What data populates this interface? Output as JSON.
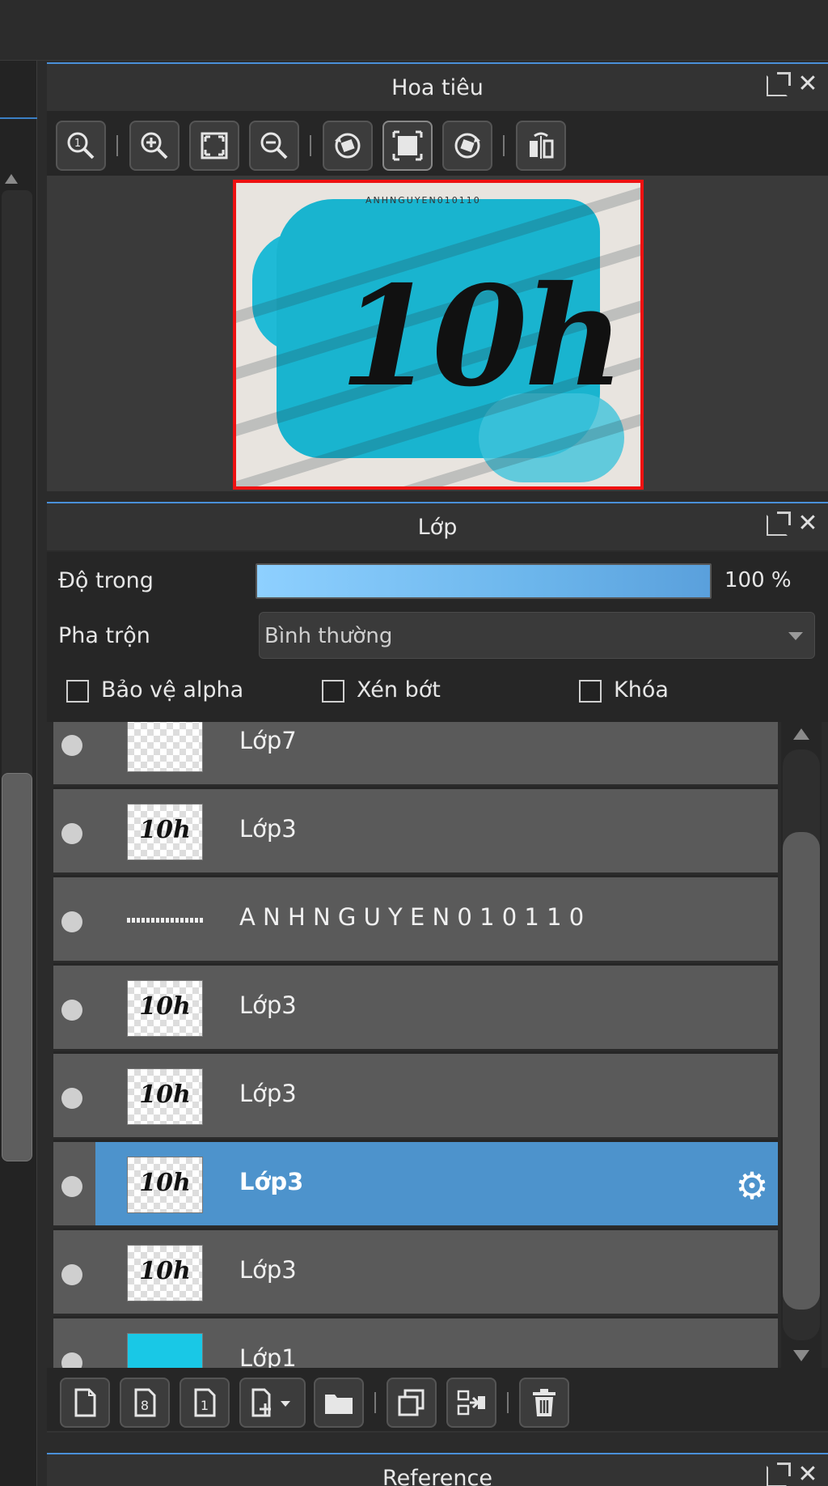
{
  "navigator": {
    "title": "Hoa tiêu",
    "preview_big_text": "10h",
    "preview_small_text": "ANHNGUYEN010110",
    "toolbar": [
      {
        "icon": "zoom-actual-icon"
      },
      {
        "icon": "zoom-in-icon"
      },
      {
        "icon": "fit-window-icon"
      },
      {
        "icon": "zoom-out-icon"
      },
      {
        "icon": "rotate-left-icon"
      },
      {
        "icon": "reset-view-icon"
      },
      {
        "icon": "rotate-right-icon"
      },
      {
        "icon": "flip-icon"
      }
    ]
  },
  "layers": {
    "title": "Lớp",
    "opacity_label": "Độ trong",
    "opacity_value": "100 %",
    "blend_label": "Pha trộn",
    "blend_value": "Bình thường",
    "protect_alpha": "Bảo vệ alpha",
    "clipping": "Xén bớt",
    "lock": "Khóa",
    "items": [
      {
        "name": "Lớp7",
        "thumb": "empty",
        "selected": false
      },
      {
        "name": "Lớp3",
        "thumb": "10h",
        "selected": false
      },
      {
        "name": "A N H N G U Y E N 0 1 0 1 1 0",
        "thumb": "text",
        "selected": false
      },
      {
        "name": "Lớp3",
        "thumb": "10h",
        "selected": false
      },
      {
        "name": "Lớp3",
        "thumb": "10h",
        "selected": false
      },
      {
        "name": "Lớp3",
        "thumb": "10h",
        "selected": true
      },
      {
        "name": "Lớp3",
        "thumb": "10h",
        "selected": false
      },
      {
        "name": "Lớp1",
        "thumb": "cyan",
        "selected": false
      }
    ],
    "thumb_text": "10h",
    "toolbar": [
      {
        "icon": "new-layer-icon"
      },
      {
        "icon": "new-8bit-layer-icon"
      },
      {
        "icon": "new-1bit-layer-icon"
      },
      {
        "icon": "add-layer-dropdown-icon"
      },
      {
        "icon": "folder-icon"
      },
      {
        "icon": "duplicate-layer-icon"
      },
      {
        "icon": "merge-down-icon"
      },
      {
        "icon": "trash-icon"
      }
    ]
  },
  "reference": {
    "title": "Reference"
  },
  "colors": {
    "accent": "#4a90d9",
    "selected_row": "#4d93cc",
    "row": "#5a5a5a",
    "preview_border": "#ee1111",
    "splash": "#19b4cf"
  }
}
